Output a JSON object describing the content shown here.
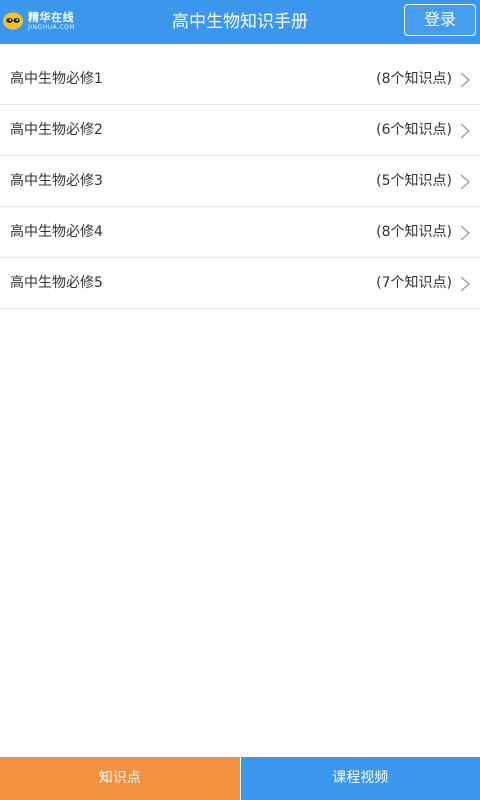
{
  "header": {
    "logo_cn": "精华在线",
    "logo_en": "JINGHUA.COM",
    "title": "高中生物知识手册",
    "login_label": "登录"
  },
  "list": {
    "items": [
      {
        "label": "高中生物必修1",
        "count": "(8个知识点)"
      },
      {
        "label": "高中生物必修2",
        "count": "(6个知识点)"
      },
      {
        "label": "高中生物必修3",
        "count": "(5个知识点)"
      },
      {
        "label": "高中生物必修4",
        "count": "(8个知识点)"
      },
      {
        "label": "高中生物必修5",
        "count": "(7个知识点)"
      }
    ]
  },
  "tabs": {
    "left_label": "知识点",
    "right_label": "课程视频"
  },
  "colors": {
    "header_blue": "#3b97ee",
    "tab_orange": "#f2913f",
    "chevron": "#9a9a9a"
  },
  "icons": {
    "logo": "jinghua-logo-icon",
    "chevron": "chevron-right-icon"
  }
}
